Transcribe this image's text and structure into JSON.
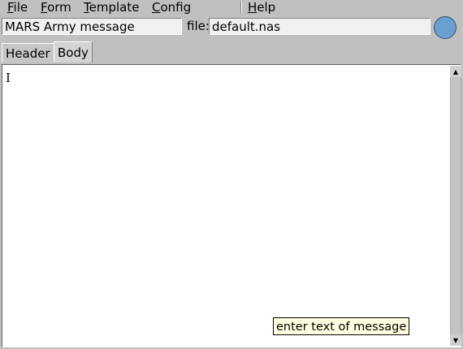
{
  "menu": {
    "items": [
      {
        "accel": "F",
        "rest": "ile"
      },
      {
        "accel": "F",
        "rest": "orm"
      },
      {
        "accel": "T",
        "rest": "emplate"
      },
      {
        "accel": "C",
        "rest": "onfig"
      },
      {
        "accel": "H",
        "rest": "elp"
      }
    ]
  },
  "header_fields": {
    "message_title": "MARS Army message",
    "file_label": "file:",
    "file_name": "default.nas",
    "status_color": "#6aa0d0"
  },
  "tabs": [
    {
      "label": "Header",
      "active": false
    },
    {
      "label": "Body",
      "active": true
    }
  ],
  "editor": {
    "content": "",
    "cursor_glyph": "I"
  },
  "tooltip": {
    "text": "enter text of message"
  },
  "icons": {
    "scroll_up": "scroll-up-arrow-icon",
    "scroll_down": "scroll-down-arrow-icon",
    "status": "status-circle-icon"
  }
}
